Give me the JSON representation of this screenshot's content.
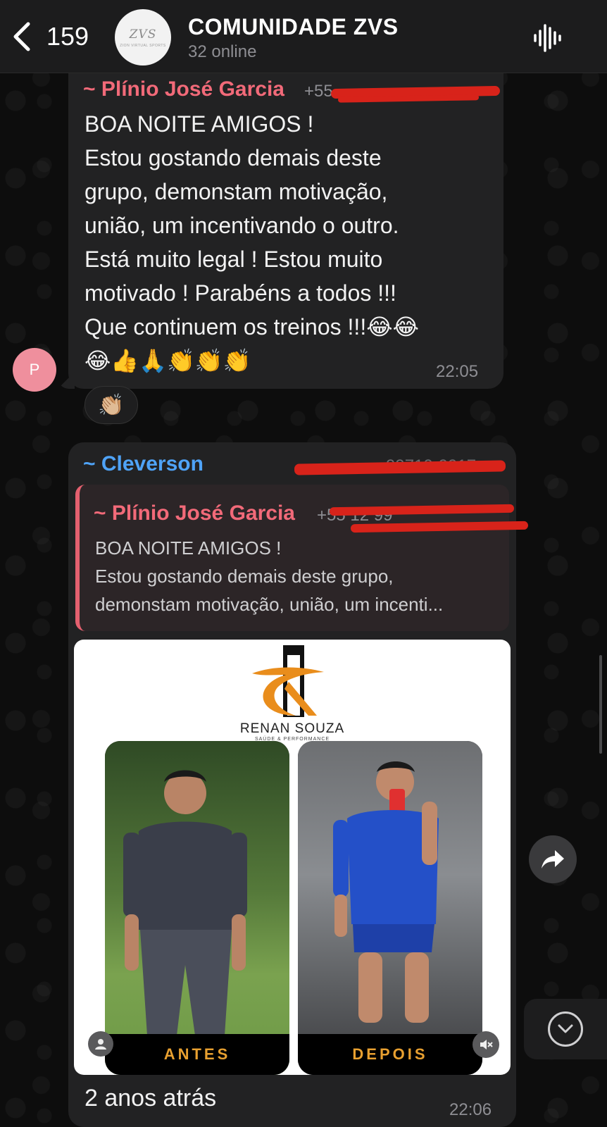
{
  "header": {
    "back_count": "159",
    "title": "COMUNIDADE ZVS",
    "subtitle": "32 online",
    "avatar_logo": "ZVS",
    "avatar_logo_sub": "ZION VIRTUAL SPORTS"
  },
  "messages": [
    {
      "sender": "~ Plínio José Garcia",
      "sender_color": "#f26a79",
      "phone": "+55",
      "text": "BOA NOITE AMIGOS !\nEstou gostando demais deste\ngrupo, demonstam motivação,\nunião, um incentivando o outro.\nEstá muito legal ! Estou muito\nmotivado ! Parabéns a todos !!!\nQue continuem os treinos !!!😂😂\n😂👍🙏👏👏👏",
      "time": "22:05",
      "avatar_letter": "P",
      "reaction": "👏🏼"
    },
    {
      "sender": "~ Cleverson",
      "sender_color": "#4fa3f7",
      "phone_visible": "99710-9917",
      "quote": {
        "sender": "~ Plínio José Garcia",
        "phone": "+55 12 99",
        "line1": "BOA NOITE AMIGOS !",
        "line2": "Estou gostando demais deste grupo,",
        "line3": "demonstam motivação, união, um incenti..."
      },
      "image": {
        "brand_name": "RENAN SOUZA",
        "brand_tag": "SAÚDE & PERFORMANCE",
        "label_before": "ANTES",
        "label_after": "DEPOIS"
      },
      "caption": "2 anos atrás",
      "time": "22:06"
    }
  ],
  "icons": {
    "back": "chevron-left-icon",
    "voice": "sound-wave-icon",
    "forward": "share-arrow-icon",
    "scroll": "chevron-down-icon",
    "user": "user-icon",
    "mute": "speaker-mute-icon"
  }
}
